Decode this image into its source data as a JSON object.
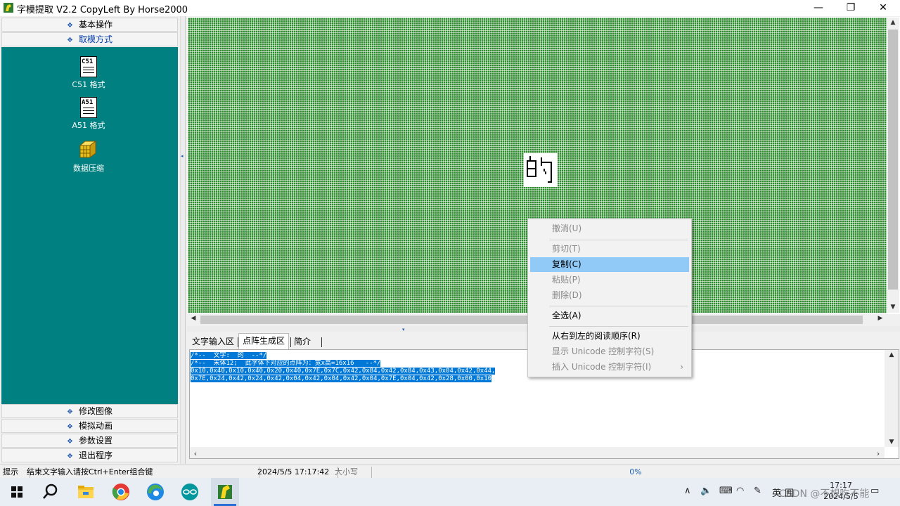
{
  "window": {
    "title": "字模提取 V2.2  CopyLeft By Horse2000",
    "minimize_glyph": "—",
    "maximize_glyph": "❐",
    "close_glyph": "✕"
  },
  "left_menu": {
    "top_items": [
      "基本操作",
      "取模方式"
    ],
    "tools": [
      {
        "label": "C51 格式",
        "icon_text": "C51",
        "icon": "c51-document-icon"
      },
      {
        "label": "A51 格式",
        "icon_text": "A51",
        "icon": "a51-document-icon"
      },
      {
        "label": "数据压缩",
        "icon": "compress-cube-icon"
      }
    ],
    "bottom_items": [
      "修改图像",
      "模拟动画",
      "参数设置",
      "退出程序"
    ]
  },
  "tabs": [
    "文字输入区",
    "点阵生成区",
    "简介"
  ],
  "output": {
    "lines": [
      "/*--  文字:  的  --*/",
      "/*--  宋体12;  此字体下对应的点阵为：宽x高=16x16   --*/",
      "0x10,0x40,0x10,0x40,0x20,0x40,0x7E,0x7C,0x42,0x84,0x42,0x84,0x43,0x04,0x42,0x44,",
      "0x7E,0x24,0x42,0x24,0x42,0x04,0x42,0x04,0x42,0x04,0x7E,0x04,0x42,0x28,0x00,0x10"
    ]
  },
  "context_menu": {
    "items": [
      {
        "label": "撤消(U)",
        "enabled": false
      },
      {
        "label": "剪切(T)",
        "enabled": false
      },
      {
        "label": "复制(C)",
        "enabled": true,
        "highlighted": true
      },
      {
        "label": "粘贴(P)",
        "enabled": false
      },
      {
        "label": "删除(D)",
        "enabled": false
      },
      {
        "label": "全选(A)",
        "enabled": true
      },
      {
        "label": "从右到左的阅读顺序(R)",
        "enabled": true
      },
      {
        "label": "显示 Unicode 控制字符(S)",
        "enabled": false
      },
      {
        "label": "插入 Unicode 控制字符(I)",
        "enabled": false,
        "submenu_glyph": "›"
      }
    ]
  },
  "statusbar": {
    "hint_label": "提示",
    "hint_text": "结束文字输入请按Ctrl+Enter组合键",
    "datetime": "2024/5/5 17:17:42",
    "caps": "大小写",
    "progress": "0%"
  },
  "taskbar": {
    "clock_time": "17:17",
    "clock_date": "2024/5/5",
    "lang": "英",
    "ime": "囲",
    "watermark": "CSDN @不想吃不能"
  },
  "colors": {
    "teal_panel": "#008080",
    "grid_green": "#2e8b2e",
    "selection": "#0078d7",
    "menu_highlight": "#91c9f7"
  }
}
